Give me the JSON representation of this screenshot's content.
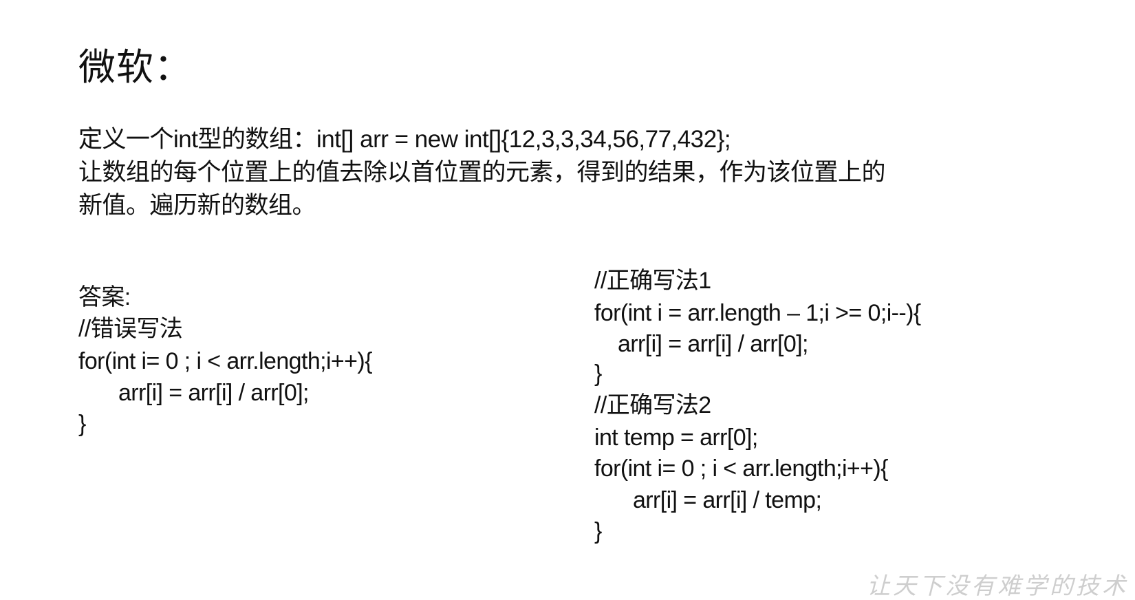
{
  "slide": {
    "title": "微软：",
    "problem": [
      "定义一个int型的数组：int[] arr = new int[]{12,3,3,34,56,77,432};",
      "让数组的每个位置上的值去除以首位置的元素，得到的结果，作为该位置上的",
      "新值。遍历新的数组。"
    ],
    "answer": {
      "label": "答案:",
      "wrong_comment": "//错误写法",
      "wrong_code": [
        "for(int i= 0 ; i < arr.length;i++){",
        "arr[i] = arr[i] / arr[0];",
        "}"
      ]
    },
    "correct1": {
      "comment": "//正确写法1",
      "code": [
        "for(int i = arr.length – 1;i >= 0;i--){",
        "arr[i] = arr[i] / arr[0];",
        "}"
      ]
    },
    "correct2": {
      "comment": "//正确写法2",
      "code": [
        "int temp = arr[0];",
        "for(int i= 0 ; i < arr.length;i++){",
        "arr[i] = arr[i] / temp;",
        "}"
      ]
    },
    "watermark": "让天下没有难学的技术"
  }
}
